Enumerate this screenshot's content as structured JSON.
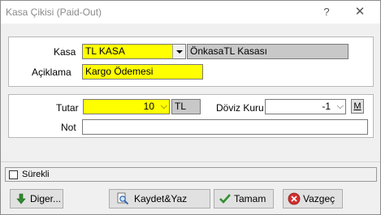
{
  "window": {
    "title": "Kasa Çikisi (Paid-Out)",
    "help_glyph": "?",
    "close_glyph": "✕"
  },
  "form": {
    "kasa_label": "Kasa",
    "kasa_value": "TL KASA",
    "kasa_name": "ÖnkasaTL Kasası",
    "aciklama_label": "Açiklama",
    "aciklama_value": "Kargo Ödemesi",
    "tutar_label": "Tutar",
    "tutar_value": "10",
    "currency": "TL",
    "doviz_label": "Döviz Kuru",
    "doviz_value": "-1",
    "m_button": "M",
    "not_label": "Not",
    "not_value": ""
  },
  "status": {
    "surekli_label": "Sürekli"
  },
  "buttons": {
    "diger": "Diger...",
    "kaydet": "Kaydet&Yaz",
    "tamam": "Tamam",
    "vazgec": "Vazgeç"
  },
  "colors": {
    "required_field": "#ffff00",
    "readonly_field": "#c8c8c8",
    "window_bg": "#f0f0f0"
  }
}
